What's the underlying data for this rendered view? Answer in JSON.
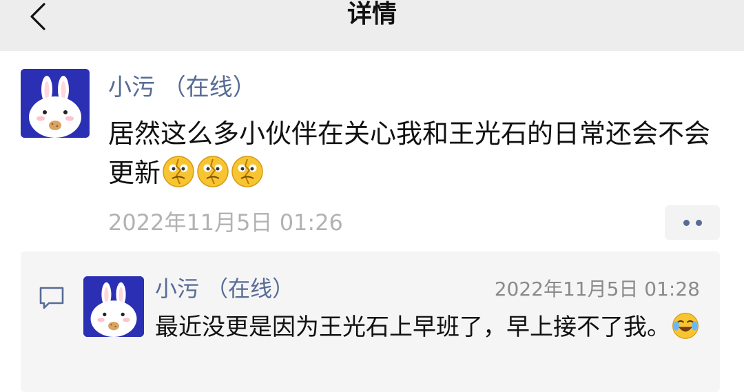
{
  "nav": {
    "title": "详情",
    "back_icon": "chevron-left-icon"
  },
  "post": {
    "author": "小污 （在线）",
    "content_text": "居然这么多小伙伴在关心我和王光石的日常还会不会更新",
    "content_emojis": [
      "broken-heart-face-emoji",
      "broken-heart-face-emoji",
      "broken-heart-face-emoji"
    ],
    "timestamp": "2022年11月5日 01:26",
    "more_icon": "more-dots-icon",
    "avatar": "bunny-avatar"
  },
  "reply": {
    "icon": "comment-bubble-icon",
    "author": "小污 （在线）",
    "timestamp": "2022年11月5日 01:28",
    "content_text": "最近没更是因为王光石上早班了，早上接不了我。",
    "content_emoji": "crying-laughing-emoji",
    "avatar": "bunny-avatar"
  },
  "colors": {
    "topbar_bg": "#ededed",
    "link_blue": "#576b95",
    "avatar_bg": "#2a2fb3",
    "panel_bg": "#f5f5f5",
    "muted_text": "#b2b2b2"
  }
}
